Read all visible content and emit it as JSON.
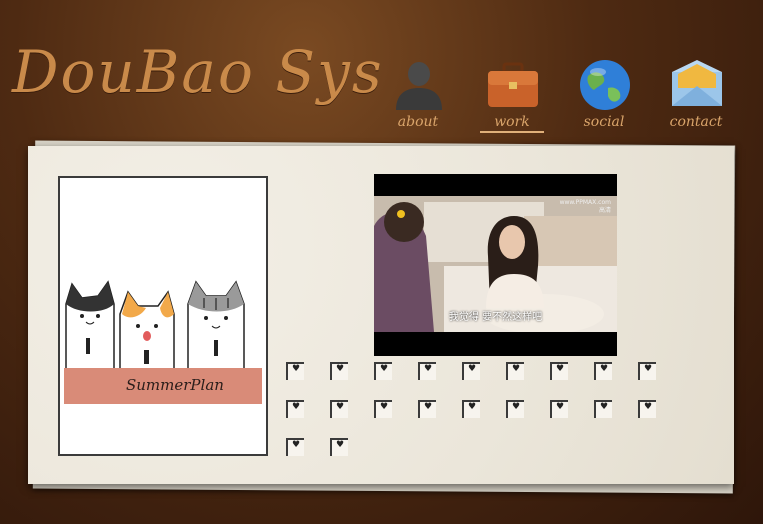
{
  "site": {
    "logo_text": "DouBao Sys"
  },
  "nav": {
    "items": [
      {
        "label": "about",
        "icon": "user-silhouette-icon"
      },
      {
        "label": "work",
        "icon": "briefcase-icon",
        "active": true
      },
      {
        "label": "social",
        "icon": "globe-icon"
      },
      {
        "label": "contact",
        "icon": "envelope-icon"
      }
    ]
  },
  "featured_image": {
    "caption": "SummerPlan"
  },
  "video": {
    "subtitle": "我觉得 要不然这样吧",
    "watermark_line1": "www.PPMAX.com",
    "watermark_line2": "高清"
  },
  "gallery": {
    "thumbnail_count": 20
  }
}
